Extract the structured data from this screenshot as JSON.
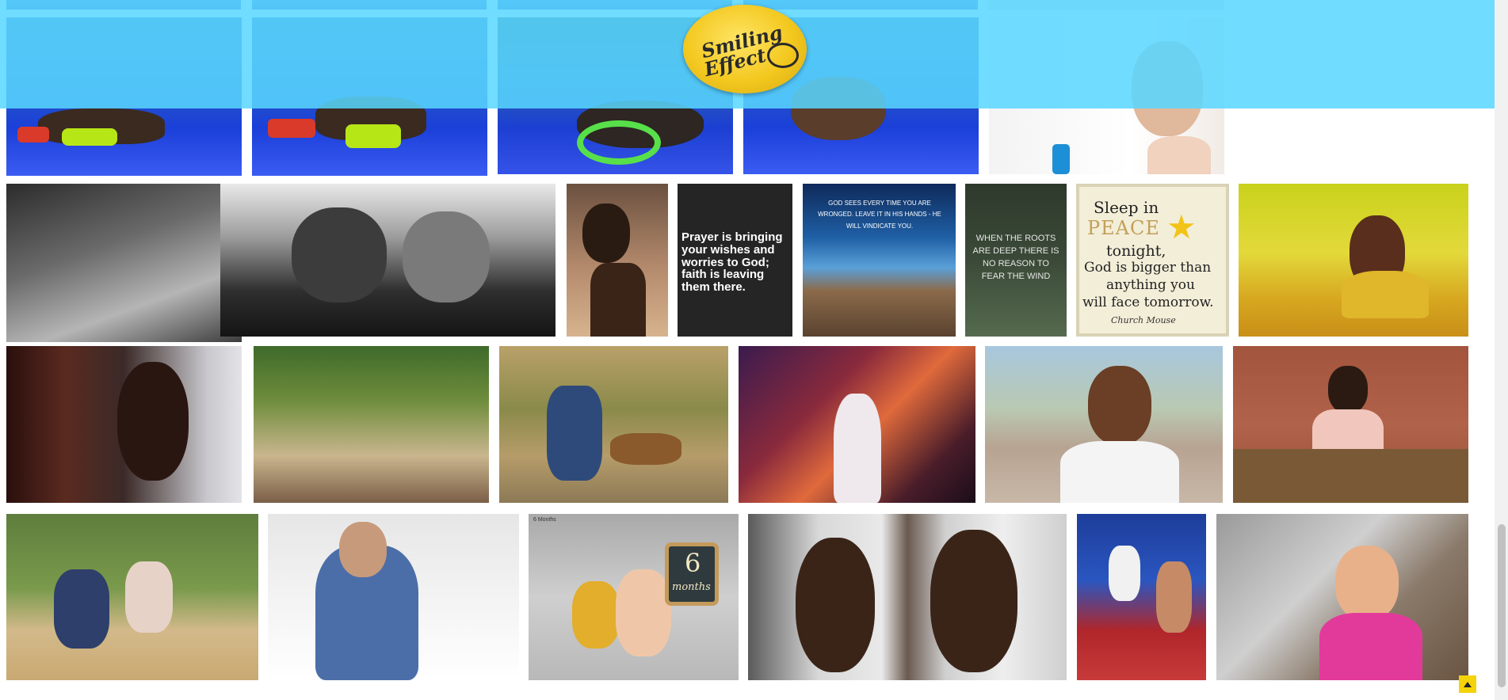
{
  "site": {
    "logo_line1": "Smiling",
    "logo_line2": "Effect"
  },
  "quotes": {
    "prayer": "Prayer is bringing your wishes and worries to God; faith is leaving them there.",
    "god_sees": "GOD SEES EVERY TIME YOU ARE WRONGED. LEAVE IT IN HIS HANDS - HE WILL VINDICATE YOU.",
    "roots": "WHEN THE ROOTS ARE DEEP THERE IS NO REASON TO FEAR THE WIND",
    "sleep_line1": "Sleep in",
    "sleep_line2": "PEACE",
    "sleep_line3": "tonight,",
    "sleep_line4": "God is bigger than",
    "sleep_line5": "anything you",
    "sleep_line6": "will face tomorrow.",
    "church_mouse": "Church Mouse",
    "six_months_number": "6",
    "six_months_word": "months",
    "six_months_caption": "6 Months"
  },
  "colors": {
    "header_overlay": "#58d6ff",
    "logo_yellow": "#f3c81f",
    "back_to_top": "#f5d30a"
  },
  "icons": {
    "back_to_top": "caret-up-icon"
  }
}
